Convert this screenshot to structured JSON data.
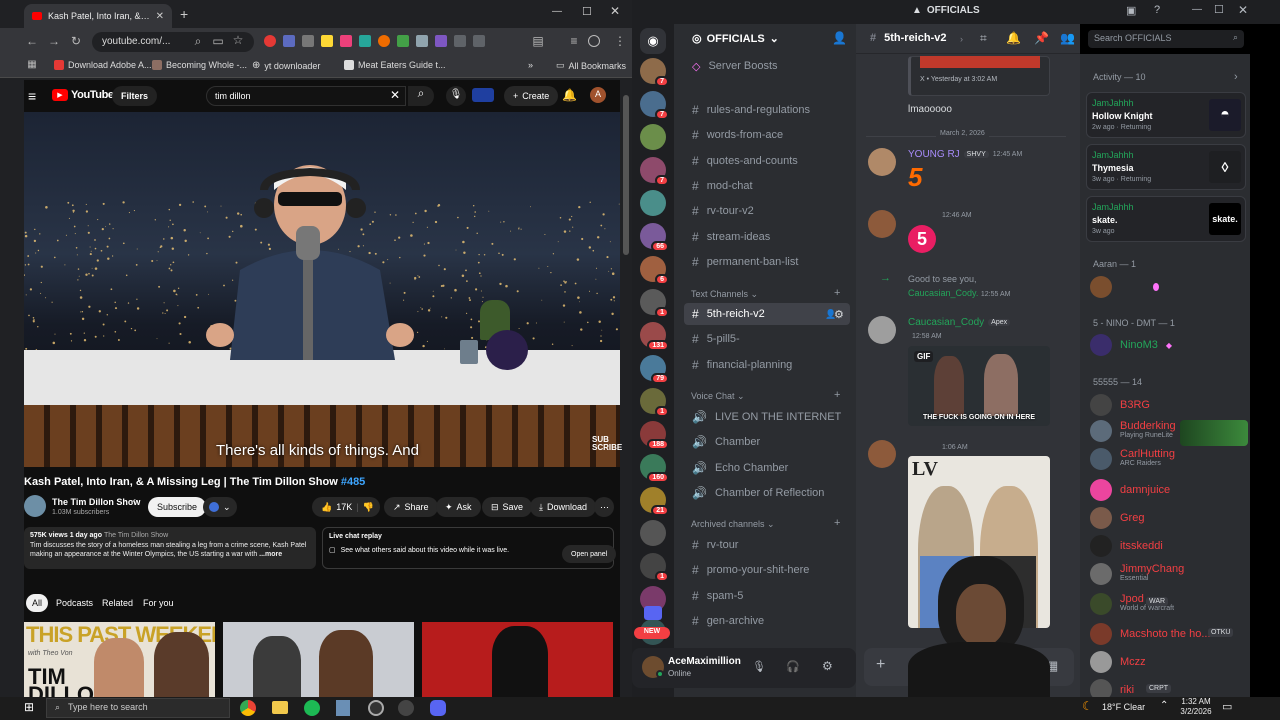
{
  "chrome": {
    "tab_title": "Kash Patel, Into Iran, & A M",
    "url": "youtube.com/...",
    "bookmarks": [
      "Download Adobe A...",
      "Becoming Whole -...",
      "yt downloader",
      "Meat Eaters Guide t..."
    ],
    "all_bookmarks": "All Bookmarks"
  },
  "youtube": {
    "logo": "YouTube",
    "filters": "Filters",
    "search_value": "tim dillon",
    "create": "Create",
    "avatar_letter": "A",
    "caption": "There's all kinds of things. And",
    "subscribe_watermark": "SUB SCRIBE",
    "title": "Kash Patel, Into Iran, & A Missing Leg | The Tim Dillon Show",
    "episode": "#485",
    "channel": "The Tim Dillon Show",
    "subscribers": "1.03M subscribers",
    "subscribe": "Subscribe",
    "likes": "17K",
    "share": "Share",
    "ask": "Ask",
    "save": "Save",
    "download": "Download",
    "views": "575K views  1 day ago",
    "views_channel": "The Tim Dillon Show",
    "description": "Tim discusses the story of a homeless man stealing a leg from a crime scene, Kash Patel making an appearance at the Winter Olympics, the US starting a war with",
    "more": "...more",
    "live_replay": "Live chat replay",
    "live_replay_text": "See what others said about this video while it was live.",
    "open_panel": "Open panel",
    "chips": [
      "All",
      "Podcasts",
      "Related",
      "For you"
    ],
    "thumb1_text": "THIS PAST WEEKEND",
    "thumb1_sub": "TIM DILLON",
    "thumb1_with": "with Theo Von"
  },
  "discord": {
    "app_title": "OFFICIALS",
    "server": "OFFICIALS",
    "server_boosts": "Server Boosts",
    "channels_top": [
      "rules-and-regulations",
      "words-from-ace",
      "quotes-and-counts",
      "mod-chat",
      "rv-tour-v2",
      "stream-ideas",
      "permanent-ban-list"
    ],
    "text_section": "Text Channels",
    "text_channels": [
      "5th-reich-v2",
      "5-pill5-",
      "financial-planning"
    ],
    "voice_section": "Voice Chat",
    "voice_channels": [
      "LIVE ON THE INTERNET",
      "Chamber",
      "Echo Chamber",
      "Chamber of Reflection"
    ],
    "archived_section": "Archived channels",
    "archived_channels": [
      "rv-tour",
      "promo-your-shit-here",
      "spam-5",
      "gen-archive"
    ],
    "user": "AceMaximillion",
    "user_status": "Online",
    "new_badge": "NEW",
    "channel_header": "5th-reich-v2",
    "search": "Search OFFICIALS",
    "reply_meta": "X • Yesterday at 3:02 AM",
    "msg_lmao": "lmaooooo",
    "date_div": "March 2, 2026",
    "young_rj": "YOUNG RJ",
    "shvy": "SHVY",
    "t1": "12:45 AM",
    "t2": "12:46 AM",
    "join_text": "Good to see you,",
    "join_user": "Caucasian_Cody.",
    "t3": "12:55 AM",
    "cody": "Caucasian_Cody",
    "apex": "Apex",
    "t4": "12:58 AM",
    "gif": "GIF",
    "gif_caption": "THE FUCK IS GOING ON IN HERE",
    "t5": "1:06 AM",
    "activity": "Activity — 10",
    "activities": [
      {
        "user": "JamJahhh",
        "game": "Hollow Knight",
        "meta": "2w ago · Returning"
      },
      {
        "user": "JamJahhh",
        "game": "Thymesia",
        "meta": "3w ago · Returning"
      },
      {
        "user": "JamJahhh",
        "game": "skate.",
        "meta": "3w ago"
      }
    ],
    "skate_logo": "skate.",
    "role1": "Aaran — 1",
    "role2": "5 - NINO - DMT — 1",
    "nino": "NinoM3",
    "role3": "55555 — 14",
    "members": [
      {
        "name": "B3RG",
        "sub": "",
        "color": "#f23f43"
      },
      {
        "name": "Budderking",
        "sub": "Playing RuneLite",
        "color": "#f23f43"
      },
      {
        "name": "CarlHutting",
        "sub": "ARC Raiders",
        "color": "#f23f43"
      },
      {
        "name": "damnjuice",
        "sub": "",
        "color": "#f23f43"
      },
      {
        "name": "Greg",
        "sub": "",
        "color": "#f23f43"
      },
      {
        "name": "itsskeddi",
        "sub": "",
        "color": "#f23f43"
      },
      {
        "name": "JimmyChang",
        "sub": "Essential",
        "color": "#f23f43"
      },
      {
        "name": "Jpod",
        "sub": "World of Warcraft",
        "color": "#f23f43"
      },
      {
        "name": "Macshoto the ho...",
        "sub": "",
        "color": "#f23f43"
      },
      {
        "name": "Mczz",
        "sub": "",
        "color": "#f23f43"
      },
      {
        "name": "riki",
        "sub": "",
        "color": "#f23f43"
      }
    ],
    "tags": {
      "war": "WAR",
      "otku": "OTKU",
      "crpt": "CRPT"
    },
    "server_badges": [
      "7",
      "7",
      "",
      "7",
      "",
      "66",
      "6",
      "1",
      "131",
      "79",
      "1",
      "188",
      "160",
      "21",
      "",
      "1",
      "",
      ""
    ]
  },
  "taskbar": {
    "search": "Type here to search",
    "weather": "18°F  Clear",
    "time": "1:32 AM",
    "date": "3/2/2026"
  },
  "colors": {
    "discord_green": "#2dc770",
    "youtube_red": "#ff0000",
    "role_red": "#f23f43"
  }
}
